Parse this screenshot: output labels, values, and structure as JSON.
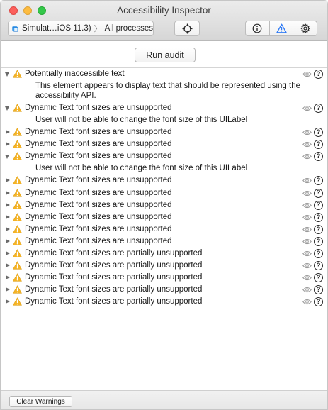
{
  "window": {
    "title": "Accessibility Inspector"
  },
  "toolbar": {
    "target_device": "Simulat…iOS 11.3)",
    "target_process": "All processes",
    "icons": {
      "target": "simulator-icon",
      "inspect": "crosshair-icon",
      "inspection": "info-icon",
      "audit": "warning-icon",
      "settings": "gear-icon"
    }
  },
  "audit": {
    "run_label": "Run audit"
  },
  "warnings": [
    {
      "title": "Potentially inaccessible text",
      "expanded": true,
      "detail": "This element appears to display text that should be represented using the accessibility API."
    },
    {
      "title": "Dynamic Text font sizes are unsupported",
      "expanded": true,
      "detail": "User will not be able to change the font size of this UILabel"
    },
    {
      "title": "Dynamic Text font sizes are unsupported",
      "expanded": false
    },
    {
      "title": "Dynamic Text font sizes are unsupported",
      "expanded": false
    },
    {
      "title": "Dynamic Text font sizes are unsupported",
      "expanded": true,
      "detail": "User will not be able to change the font size of this UILabel"
    },
    {
      "title": "Dynamic Text font sizes are unsupported",
      "expanded": false
    },
    {
      "title": "Dynamic Text font sizes are unsupported",
      "expanded": false
    },
    {
      "title": "Dynamic Text font sizes are unsupported",
      "expanded": false
    },
    {
      "title": "Dynamic Text font sizes are unsupported",
      "expanded": false
    },
    {
      "title": "Dynamic Text font sizes are unsupported",
      "expanded": false
    },
    {
      "title": "Dynamic Text font sizes are unsupported",
      "expanded": false
    },
    {
      "title": "Dynamic Text font sizes are partially unsupported",
      "expanded": false
    },
    {
      "title": "Dynamic Text font sizes are partially unsupported",
      "expanded": false
    },
    {
      "title": "Dynamic Text font sizes are partially unsupported",
      "expanded": false
    },
    {
      "title": "Dynamic Text font sizes are partially unsupported",
      "expanded": false
    },
    {
      "title": "Dynamic Text font sizes are partially unsupported",
      "expanded": false
    }
  ],
  "row_icons": {
    "warning": "warning-icon",
    "preview": "eye-icon",
    "help": "help-icon",
    "help_glyph": "?"
  },
  "colors": {
    "warning": "#f5b324",
    "audit_selected": "#2f7bf5"
  },
  "footer": {
    "clear_label": "Clear Warnings"
  }
}
